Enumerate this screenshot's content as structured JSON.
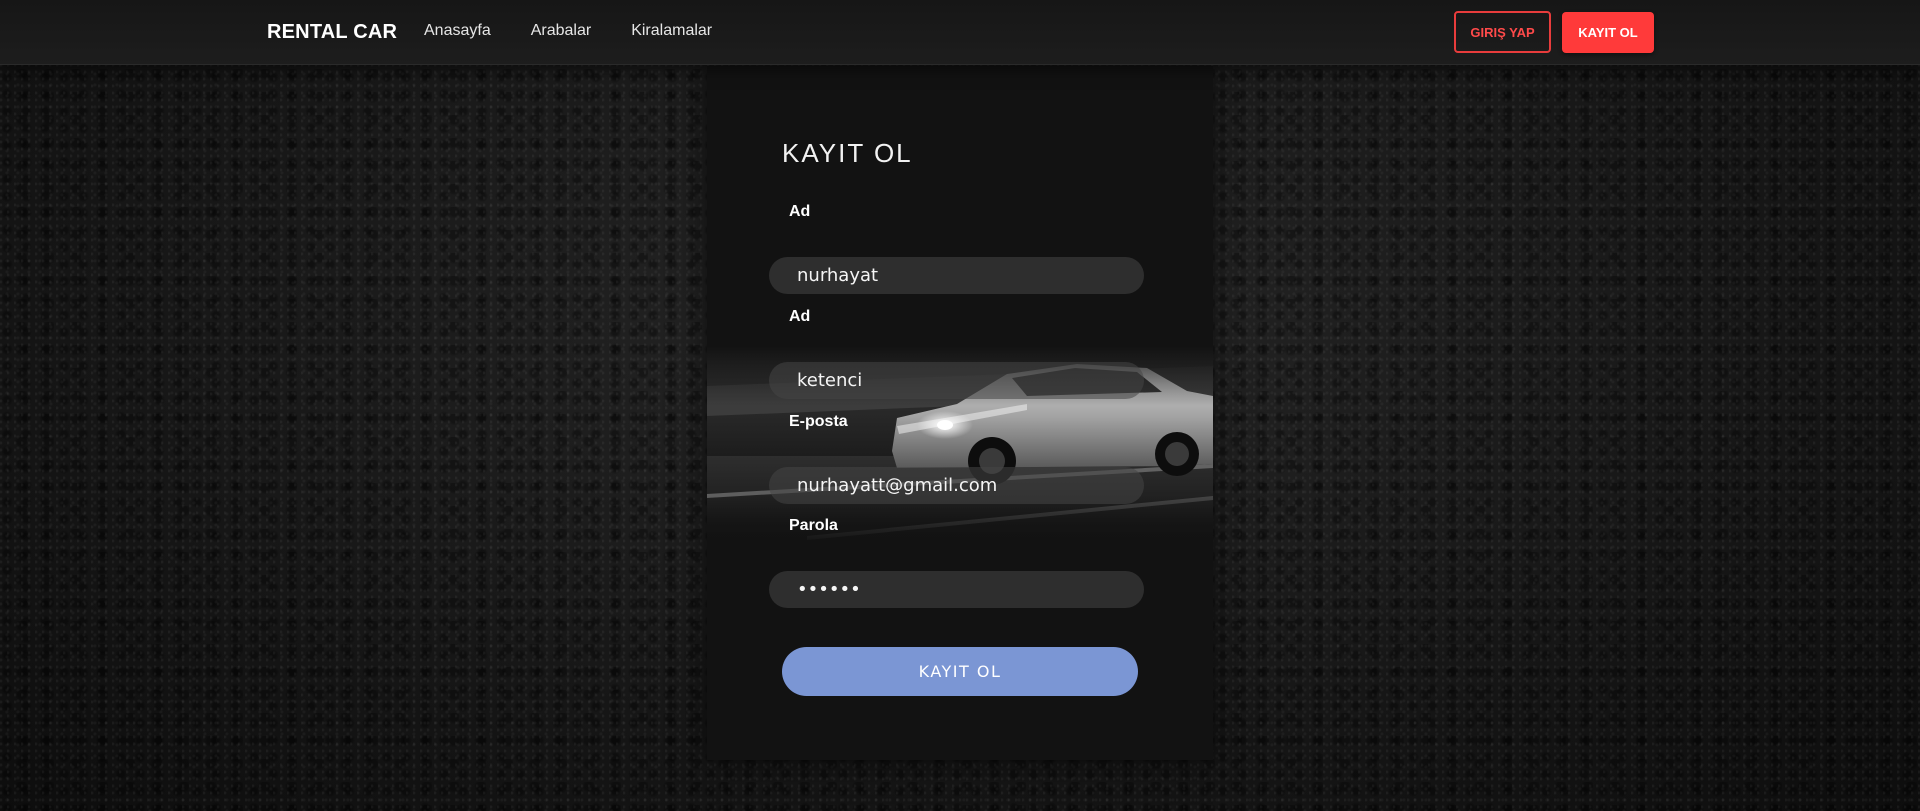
{
  "navbar": {
    "brand": "RENTAL CAR",
    "links": [
      "Anasayfa",
      "Arabalar",
      "Kiralamalar"
    ],
    "login_label": "GIRIŞ YAP",
    "register_label": "KAYIT OL"
  },
  "form": {
    "title": "KAYIT OL",
    "fields": [
      {
        "label": "Ad",
        "value": "nurhayat",
        "type": "text"
      },
      {
        "label": "Ad",
        "value": "ketenci",
        "type": "text"
      },
      {
        "label": "E-posta",
        "value": "nurhayatt@gmail.com",
        "type": "email"
      },
      {
        "label": "Parola",
        "value": "••••••",
        "type": "password"
      }
    ],
    "submit_label": "KAYIT OL"
  },
  "colors": {
    "accent_red": "#ff3a3a",
    "submit_blue": "#7b96d4",
    "card_bg": "#121212"
  }
}
